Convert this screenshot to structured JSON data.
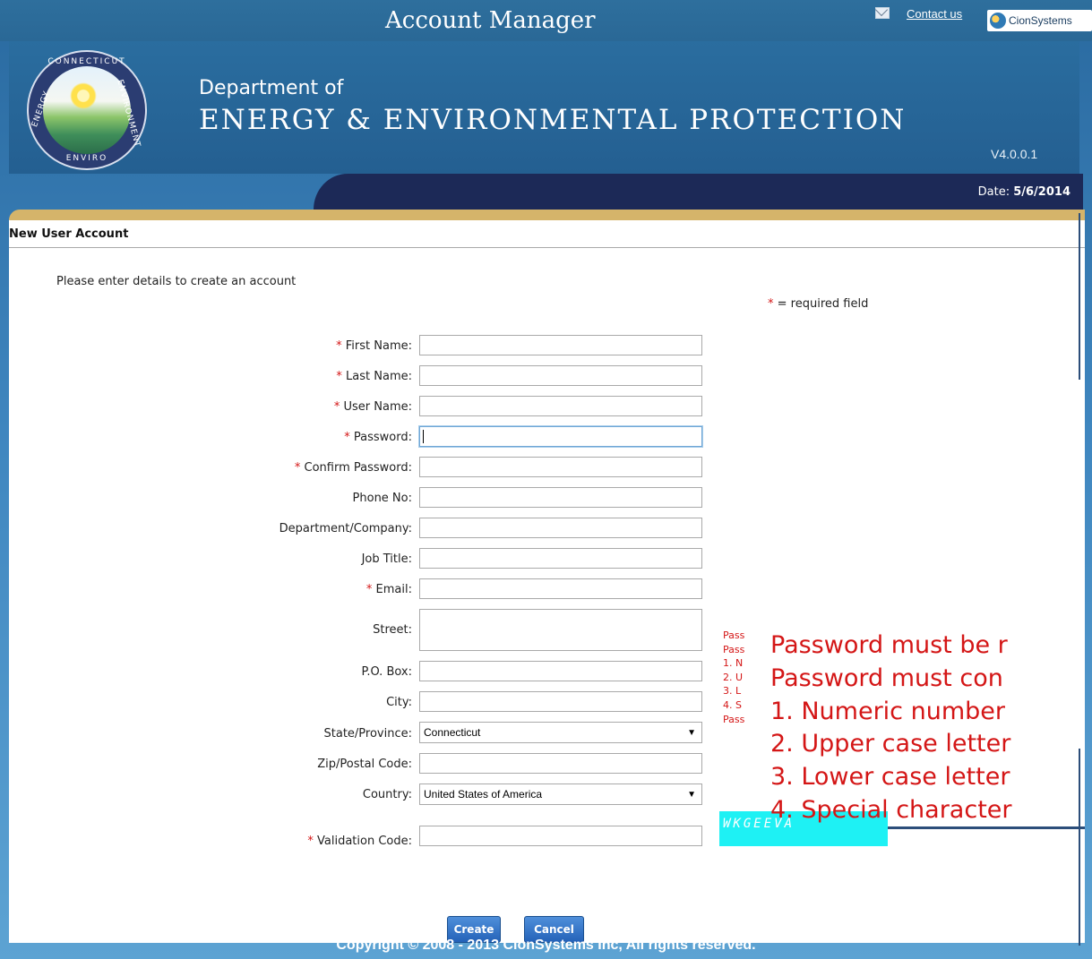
{
  "header": {
    "app_title": "Account Manager",
    "contact_label": "Contact us",
    "brand_label": "CionSystems"
  },
  "banner": {
    "seal_top": "CONNECTICUT",
    "seal_left": "ENERGY",
    "seal_right": "ENVIRONMENT",
    "seal_bottom": "ENVIRO",
    "dept_of": "Department of",
    "dept_name": "ENERGY & ENVIRONMENTAL PROTECTION",
    "version": "V4.0.0.1",
    "date_label": "Date:",
    "date_value": "5/6/2014"
  },
  "form": {
    "section_title": "New User Account",
    "intro": "Please enter details to create an account",
    "required_note_star": "*",
    "required_note_text": "= required field",
    "fields": {
      "first_name": "First Name:",
      "last_name": "Last Name:",
      "user_name": "User Name:",
      "password": "Password:",
      "confirm_password": "Confirm Password:",
      "phone": "Phone No:",
      "department": "Department/Company:",
      "job_title": "Job Title:",
      "email": "Email:",
      "street": "Street:",
      "po_box": "P.O. Box:",
      "city": "City:",
      "state": "State/Province:",
      "zip": "Zip/Postal Code:",
      "country": "Country:",
      "validation": "Validation Code:"
    },
    "state_value": "Connecticut",
    "country_value": "United States of America",
    "captcha_text": "WKGEEVA",
    "create_label": "Create",
    "cancel_label": "Cancel"
  },
  "password_hint": {
    "small": [
      "Pass",
      "Pass",
      "1. N",
      "2. U",
      "3. L",
      "4. S",
      "Pass"
    ],
    "big": [
      "Password must be r",
      "Password must con",
      "1. Numeric number",
      "2. Upper case letter",
      "3. Lower case letter",
      "4. Special character"
    ]
  },
  "footer": {
    "copyright": "Copyright © 2008 - 2013 CionSystems Inc, All rights reserved."
  },
  "colors": {
    "required": "#d41616",
    "banner": "#245f91",
    "accent": "#d5b46a",
    "captcha_bg": "#1ef1f4"
  }
}
